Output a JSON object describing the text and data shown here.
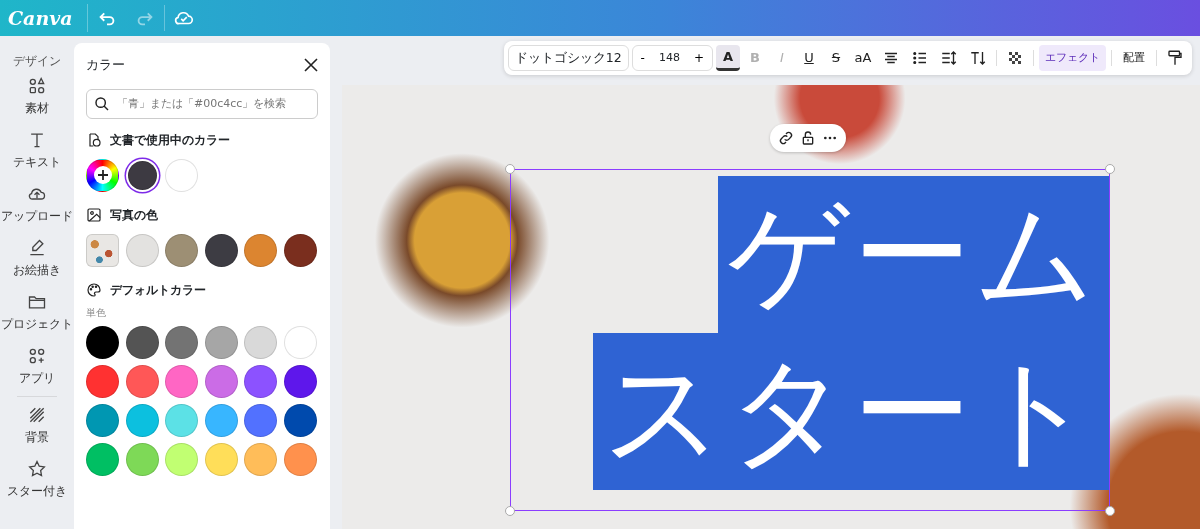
{
  "topbar": {
    "logo": "Canva"
  },
  "sidebar": {
    "items": [
      {
        "label": "デザイン"
      },
      {
        "label": "素材"
      },
      {
        "label": "テキスト"
      },
      {
        "label": "アップロード"
      },
      {
        "label": "お絵描き"
      },
      {
        "label": "プロジェクト"
      },
      {
        "label": "アプリ"
      },
      {
        "label": "背景"
      },
      {
        "label": "スター付き"
      }
    ]
  },
  "color_panel": {
    "title": "カラー",
    "search": {
      "placeholder": "「青」または「#00c4cc」を検索"
    },
    "sections": [
      {
        "kind": "document",
        "title": "文書で使用中のカラー",
        "swatches": [
          {
            "kind": "add",
            "selected": false
          },
          {
            "kind": "color",
            "color": "#3d3a42",
            "selected": true
          },
          {
            "kind": "color",
            "color": "#ffffff",
            "selected": false
          }
        ]
      },
      {
        "kind": "photo",
        "title": "写真の色",
        "swatches": [
          {
            "kind": "photo",
            "selected": false
          },
          {
            "kind": "color",
            "color": "#e3e2e0",
            "selected": false
          },
          {
            "kind": "color",
            "color": "#9d8f74",
            "selected": false
          },
          {
            "kind": "color",
            "color": "#3d3c43",
            "selected": false
          },
          {
            "kind": "color",
            "color": "#dc8530",
            "selected": false
          },
          {
            "kind": "color",
            "color": "#7a2e1e",
            "selected": false
          }
        ]
      },
      {
        "kind": "default",
        "title": "デフォルトカラー",
        "subtitle": "単色",
        "swatches": [
          {
            "kind": "color",
            "color": "#000000",
            "selected": false
          },
          {
            "kind": "color",
            "color": "#545454",
            "selected": false
          },
          {
            "kind": "color",
            "color": "#737373",
            "selected": false
          },
          {
            "kind": "color",
            "color": "#a6a6a6",
            "selected": false
          },
          {
            "kind": "color",
            "color": "#d9d9d9",
            "selected": false
          },
          {
            "kind": "color",
            "color": "#ffffff",
            "selected": false
          },
          {
            "kind": "color",
            "color": "#ff3131",
            "selected": false
          },
          {
            "kind": "color",
            "color": "#ff5757",
            "selected": false
          },
          {
            "kind": "color",
            "color": "#ff66c4",
            "selected": false
          },
          {
            "kind": "color",
            "color": "#cb6ce6",
            "selected": false
          },
          {
            "kind": "color",
            "color": "#8c52ff",
            "selected": false
          },
          {
            "kind": "color",
            "color": "#5e17eb",
            "selected": false
          },
          {
            "kind": "color",
            "color": "#0097b2",
            "selected": false
          },
          {
            "kind": "color",
            "color": "#0cc0df",
            "selected": false
          },
          {
            "kind": "color",
            "color": "#5ce1e6",
            "selected": false
          },
          {
            "kind": "color",
            "color": "#38b6ff",
            "selected": false
          },
          {
            "kind": "color",
            "color": "#5271ff",
            "selected": false
          },
          {
            "kind": "color",
            "color": "#004aad",
            "selected": false
          },
          {
            "kind": "color",
            "color": "#00bf63",
            "selected": false
          },
          {
            "kind": "color",
            "color": "#7ed957",
            "selected": false
          },
          {
            "kind": "color",
            "color": "#c1ff72",
            "selected": false
          },
          {
            "kind": "color",
            "color": "#ffde59",
            "selected": false
          },
          {
            "kind": "color",
            "color": "#ffbd59",
            "selected": false
          },
          {
            "kind": "color",
            "color": "#ff914d",
            "selected": false
          }
        ]
      }
    ]
  },
  "toolbar": {
    "font": "ドットゴシック12",
    "size": {
      "minus": "-",
      "value": "148",
      "plus": "+"
    },
    "items": [
      {
        "kind": "textcolor",
        "label": "A",
        "selected": true
      },
      {
        "kind": "letter",
        "label": "B",
        "disabled": true
      },
      {
        "kind": "letter",
        "label": "I",
        "disabled": true
      },
      {
        "kind": "letter",
        "label": "U",
        "disabled": false
      },
      {
        "kind": "letter",
        "label": "S",
        "disabled": false
      },
      {
        "kind": "letter",
        "label": "aA",
        "disabled": false
      },
      {
        "kind": "icon"
      },
      {
        "kind": "icon"
      },
      {
        "kind": "icon"
      },
      {
        "kind": "icon"
      },
      {
        "kind": "sep"
      },
      {
        "kind": "icon"
      },
      {
        "kind": "sep"
      },
      {
        "kind": "word",
        "label": "エフェクト",
        "selected": true
      },
      {
        "kind": "sep"
      },
      {
        "kind": "word",
        "label": "配置",
        "selected": false
      },
      {
        "kind": "sep"
      },
      {
        "kind": "icon"
      }
    ]
  },
  "canvas": {
    "text_lines": [
      "ゲーム",
      "スタート"
    ]
  }
}
